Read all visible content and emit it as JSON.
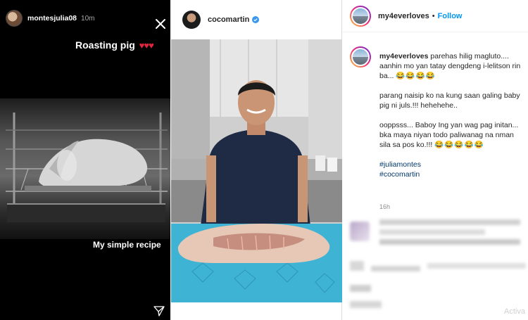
{
  "story": {
    "username": "montesjulia08",
    "time": "10m",
    "caption_top": "Roasting pig",
    "hearts": "♥♥♥",
    "caption_bottom": "My simple recipe"
  },
  "post": {
    "username": "cocomartin"
  },
  "panel": {
    "username": "my4everloves",
    "separator": "•",
    "follow_label": "Follow",
    "caption": {
      "username": "my4everloves",
      "line1": "parehas hilig magluto.... aanhin mo yan tatay dengdeng i-lelitson rin ba...",
      "emoji1": "😂😂😂😂",
      "line2": "parang naisip ko na kung saan galing baby pig ni juls.!!! hehehehe..",
      "line3": "ooppsss... Baboy Ing yan wag pag initan... bka maya niyan todo paliwanag na nman sila sa pos ko.!!!",
      "emoji2": "😂😂😂😂😂",
      "hashtags": [
        "#juliamontes",
        "#cocomartin"
      ]
    },
    "time": "16h",
    "watermark": "Activa"
  },
  "colors": {
    "link_blue": "#0095f6",
    "hashtag_blue": "#00376b",
    "heart_red": "#e0263c",
    "verified_blue": "#3897f0"
  }
}
